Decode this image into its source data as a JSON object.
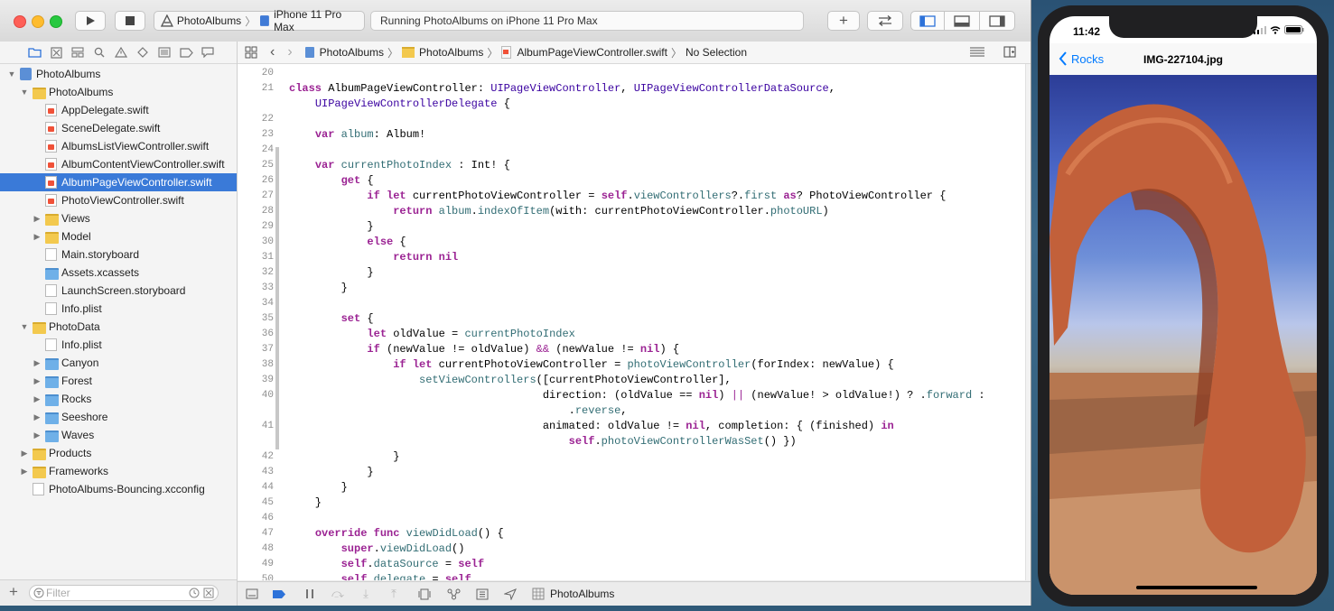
{
  "toolbar": {
    "scheme_app": "PhotoAlbums",
    "scheme_device": "iPhone 11 Pro Max",
    "activity_status": "Running PhotoAlbums on iPhone 11 Pro Max"
  },
  "navigator": {
    "tree": [
      {
        "label": "PhotoAlbums",
        "depth": 0,
        "kind": "project",
        "disclosure": "open"
      },
      {
        "label": "PhotoAlbums",
        "depth": 1,
        "kind": "folder",
        "disclosure": "open"
      },
      {
        "label": "AppDelegate.swift",
        "depth": 2,
        "kind": "swift"
      },
      {
        "label": "SceneDelegate.swift",
        "depth": 2,
        "kind": "swift"
      },
      {
        "label": "AlbumsListViewController.swift",
        "depth": 2,
        "kind": "swift"
      },
      {
        "label": "AlbumContentViewController.swift",
        "depth": 2,
        "kind": "swift"
      },
      {
        "label": "AlbumPageViewController.swift",
        "depth": 2,
        "kind": "swift",
        "selected": true
      },
      {
        "label": "PhotoViewController.swift",
        "depth": 2,
        "kind": "swift"
      },
      {
        "label": "Views",
        "depth": 2,
        "kind": "folder",
        "disclosure": "closed"
      },
      {
        "label": "Model",
        "depth": 2,
        "kind": "folder",
        "disclosure": "closed"
      },
      {
        "label": "Main.storyboard",
        "depth": 2,
        "kind": "doc"
      },
      {
        "label": "Assets.xcassets",
        "depth": 2,
        "kind": "folder-blue"
      },
      {
        "label": "LaunchScreen.storyboard",
        "depth": 2,
        "kind": "doc"
      },
      {
        "label": "Info.plist",
        "depth": 2,
        "kind": "doc"
      },
      {
        "label": "PhotoData",
        "depth": 1,
        "kind": "folder",
        "disclosure": "open"
      },
      {
        "label": "Info.plist",
        "depth": 2,
        "kind": "doc"
      },
      {
        "label": "Canyon",
        "depth": 2,
        "kind": "folder-blue",
        "disclosure": "closed"
      },
      {
        "label": "Forest",
        "depth": 2,
        "kind": "folder-blue",
        "disclosure": "closed"
      },
      {
        "label": "Rocks",
        "depth": 2,
        "kind": "folder-blue",
        "disclosure": "closed"
      },
      {
        "label": "Seeshore",
        "depth": 2,
        "kind": "folder-blue",
        "disclosure": "closed"
      },
      {
        "label": "Waves",
        "depth": 2,
        "kind": "folder-blue",
        "disclosure": "closed"
      },
      {
        "label": "Products",
        "depth": 1,
        "kind": "folder",
        "disclosure": "closed"
      },
      {
        "label": "Frameworks",
        "depth": 1,
        "kind": "folder",
        "disclosure": "closed"
      },
      {
        "label": "PhotoAlbums-Bouncing.xcconfig",
        "depth": 1,
        "kind": "doc"
      }
    ],
    "filter_placeholder": "Filter"
  },
  "jumpbar": {
    "crumbs": [
      "PhotoAlbums",
      "PhotoAlbums",
      "AlbumPageViewController.swift",
      "No Selection"
    ]
  },
  "editor": {
    "lines": [
      {
        "n": "20",
        "html": ""
      },
      {
        "n": "21",
        "html": "<span class='k'>class</span> AlbumPageViewController: <span class='t'>UIPageViewController</span>, <span class='t'>UIPageViewControllerDataSource</span>,"
      },
      {
        "n": "",
        "html": "    <span class='t'>UIPageViewControllerDelegate</span> {"
      },
      {
        "n": "22",
        "html": ""
      },
      {
        "n": "23",
        "html": "    <span class='k'>var</span> <span class='p'>album</span>: Album!"
      },
      {
        "n": "24",
        "html": ""
      },
      {
        "n": "25",
        "html": "    <span class='k'>var</span> <span class='p'>currentPhotoIndex</span> : Int! {"
      },
      {
        "n": "26",
        "html": "        <span class='k'>get</span> {"
      },
      {
        "n": "27",
        "html": "            <span class='k'>if let</span> currentPhotoViewController = <span class='k'>self</span>.<span class='p'>viewControllers</span>?.<span class='p'>first</span> <span class='k'>as</span>? PhotoViewController {"
      },
      {
        "n": "28",
        "html": "                <span class='k'>return</span> <span class='p'>album</span>.<span class='p'>indexOfItem</span>(with: currentPhotoViewController.<span class='p'>photoURL</span>)"
      },
      {
        "n": "29",
        "html": "            }"
      },
      {
        "n": "30",
        "html": "            <span class='k'>else</span> {"
      },
      {
        "n": "31",
        "html": "                <span class='k'>return</span> <span class='k'>nil</span>"
      },
      {
        "n": "32",
        "html": "            }"
      },
      {
        "n": "33",
        "html": "        }"
      },
      {
        "n": "34",
        "html": ""
      },
      {
        "n": "35",
        "html": "        <span class='k'>set</span> {"
      },
      {
        "n": "36",
        "html": "            <span class='k'>let</span> oldValue = <span class='p'>currentPhotoIndex</span>"
      },
      {
        "n": "37",
        "html": "            <span class='k'>if</span> (newValue != oldValue) <span class='o'>&amp;&amp;</span> (newValue != <span class='k'>nil</span>) {"
      },
      {
        "n": "38",
        "html": "                <span class='k'>if let</span> currentPhotoViewController = <span class='p'>photoViewController</span>(forIndex: newValue) {"
      },
      {
        "n": "39",
        "html": "                    <span class='p'>setViewControllers</span>([currentPhotoViewController],"
      },
      {
        "n": "40",
        "html": "                                       direction: (oldValue == <span class='k'>nil</span>) <span class='o'>||</span> (newValue! &gt; oldValue!) ? .<span class='p'>forward</span> :"
      },
      {
        "n": "",
        "html": "                                           .<span class='p'>reverse</span>,"
      },
      {
        "n": "41",
        "html": "                                       animated: oldValue != <span class='k'>nil</span>, completion: { (finished) <span class='k'>in</span>"
      },
      {
        "n": "",
        "html": "                                           <span class='k'>self</span>.<span class='p'>photoViewControllerWasSet</span>() })"
      },
      {
        "n": "42",
        "html": "                }"
      },
      {
        "n": "43",
        "html": "            }"
      },
      {
        "n": "44",
        "html": "        }"
      },
      {
        "n": "45",
        "html": "    }"
      },
      {
        "n": "46",
        "html": ""
      },
      {
        "n": "47",
        "html": "    <span class='k'>override func</span> <span class='p'>viewDidLoad</span>() {"
      },
      {
        "n": "48",
        "html": "        <span class='k'>super</span>.<span class='p'>viewDidLoad</span>()"
      },
      {
        "n": "49",
        "html": "        <span class='k'>self</span>.<span class='p'>dataSource</span> = <span class='k'>self</span>"
      },
      {
        "n": "50",
        "html": "        <span class='k'>self</span>.<span class='p'>delegate</span> = <span class='k'>self</span>"
      }
    ]
  },
  "debugbar": {
    "target_label": "PhotoAlbums"
  },
  "simulator": {
    "time": "11:42",
    "back_label": "Rocks",
    "title": "IMG-227104.jpg"
  },
  "colors": {
    "selection": "#3a7ad8",
    "keyword": "#9b2393",
    "type": "#3900a0",
    "project_symbol": "#326d74",
    "ios_blue": "#007aff"
  }
}
